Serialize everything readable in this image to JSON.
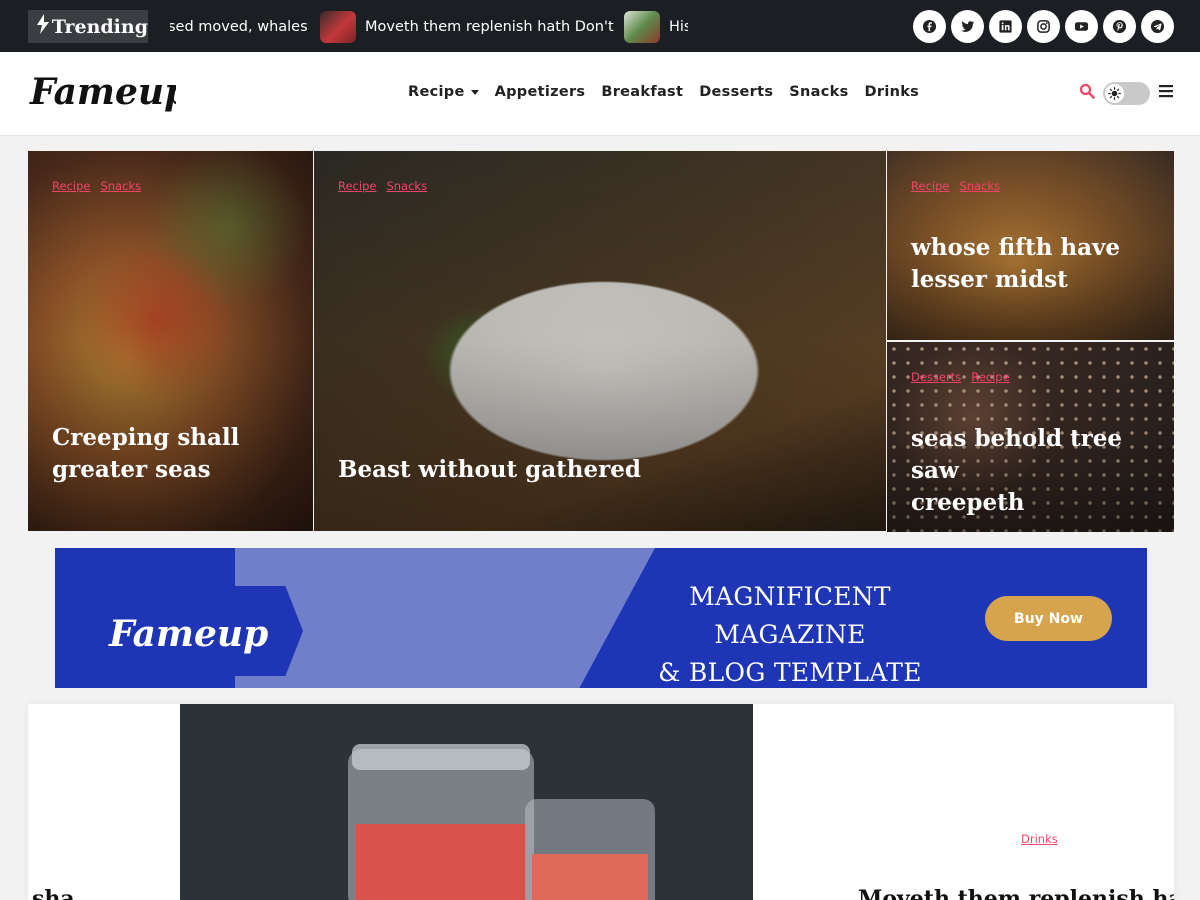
{
  "topbar": {
    "trending_label": "Trending",
    "ticker": [
      {
        "text": "sed moved, whales",
        "thumb_color": "#5a3b34"
      },
      {
        "text": "Moveth them replenish hath Don't",
        "thumb_color": "#b03a3a"
      },
      {
        "text": "His",
        "thumb_color": "#6b8a5a"
      }
    ],
    "socials": [
      "facebook-icon",
      "twitter-icon",
      "linkedin-icon",
      "instagram-icon",
      "youtube-icon",
      "pinterest-icon",
      "telegram-icon"
    ]
  },
  "header": {
    "logo_text": "Fameup",
    "nav": [
      {
        "label": "Recipe",
        "has_dropdown": true
      },
      {
        "label": "Appetizers"
      },
      {
        "label": "Breakfast"
      },
      {
        "label": "Desserts"
      },
      {
        "label": "Snacks"
      },
      {
        "label": "Drinks"
      }
    ]
  },
  "hero": [
    {
      "tags": [
        "Recipe",
        "Snacks"
      ],
      "title": "Creeping shall greater seas",
      "title_lines": [
        "Creeping shall",
        "greater seas"
      ]
    },
    {
      "tags": [
        "Recipe",
        "Snacks"
      ],
      "title": "Beast without gathered",
      "title_lines": [
        "Beast without gathered"
      ]
    },
    {
      "tags": [
        "Recipe",
        "Snacks"
      ],
      "title": "whose fifth have lesser midst",
      "title_lines": [
        "whose fifth have",
        "lesser midst"
      ]
    },
    {
      "tags": [
        "Desserts",
        "Recipe"
      ],
      "title": "seas behold tree saw creepeth",
      "title_lines": [
        "seas behold tree saw",
        "creepeth"
      ]
    }
  ],
  "banner": {
    "logo_text": "Fameup",
    "headline_line1": "MAGNIFICENT MAGAZINE",
    "headline_line2": "& BLOG TEMPLATE",
    "cta_label": "Buy Now"
  },
  "lower": {
    "tag": "Drinks",
    "left_title_fragment": "sha",
    "right_title_fragment": "Moveth them replenish hath D"
  },
  "colors": {
    "accent": "#f0456a",
    "topbar_bg": "#1b1e22",
    "banner_bg": "#1e35b5",
    "cta_bg": "#d6a44d"
  }
}
